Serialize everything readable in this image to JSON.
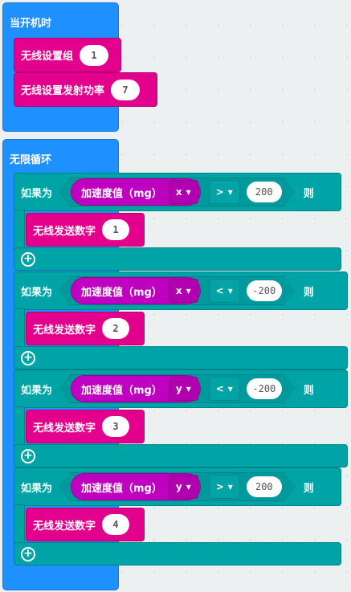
{
  "on_start": {
    "label": "当开机时",
    "blocks": [
      {
        "label": "无线设置组",
        "value": "1"
      },
      {
        "label": "无线设置发射功率",
        "value": "7"
      }
    ]
  },
  "forever": {
    "label": "无限循环",
    "ifs": [
      {
        "if_label": "如果为",
        "sensor": "加速度值（mg）",
        "axis": "x",
        "op": ">",
        "value": "200",
        "then_label": "则",
        "send_label": "无线发送数字",
        "send_value": "1"
      },
      {
        "if_label": "如果为",
        "sensor": "加速度值（mg）",
        "axis": "x",
        "op": "<",
        "value": "-200",
        "then_label": "则",
        "send_label": "无线发送数字",
        "send_value": "2"
      },
      {
        "if_label": "如果为",
        "sensor": "加速度值（mg）",
        "axis": "y",
        "op": "<",
        "value": "-200",
        "then_label": "则",
        "send_label": "无线发送数字",
        "send_value": "3"
      },
      {
        "if_label": "如果为",
        "sensor": "加速度值（mg）",
        "axis": "y",
        "op": ">",
        "value": "200",
        "then_label": "则",
        "send_label": "无线发送数字",
        "send_value": "4"
      }
    ]
  },
  "colors": {
    "event": "#1e90ff",
    "radio": "#e3008c",
    "logic": "#00a4a6",
    "input": "#c000c0",
    "background": "#ecf0f1"
  }
}
